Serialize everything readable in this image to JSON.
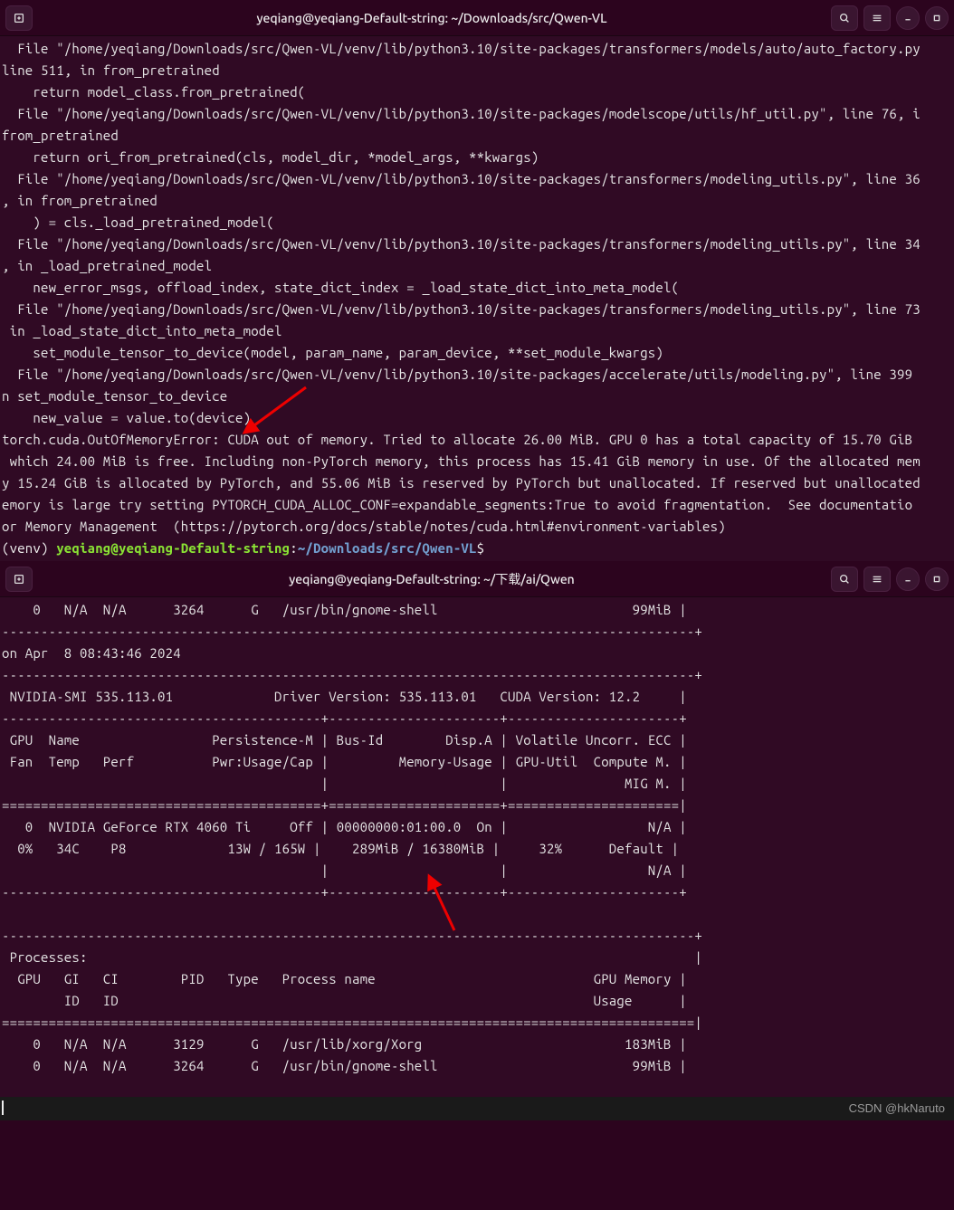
{
  "window1": {
    "title": "yeqiang@yeqiang-Default-string: ~/Downloads/src/Qwen-VL",
    "lines": [
      "  File \"/home/yeqiang/Downloads/src/Qwen-VL/venv/lib/python3.10/site-packages/transformers/models/auto/auto_factory.py",
      "line 511, in from_pretrained",
      "    return model_class.from_pretrained(",
      "  File \"/home/yeqiang/Downloads/src/Qwen-VL/venv/lib/python3.10/site-packages/modelscope/utils/hf_util.py\", line 76, i",
      "from_pretrained",
      "    return ori_from_pretrained(cls, model_dir, *model_args, **kwargs)",
      "  File \"/home/yeqiang/Downloads/src/Qwen-VL/venv/lib/python3.10/site-packages/transformers/modeling_utils.py\", line 36",
      ", in from_pretrained",
      "    ) = cls._load_pretrained_model(",
      "  File \"/home/yeqiang/Downloads/src/Qwen-VL/venv/lib/python3.10/site-packages/transformers/modeling_utils.py\", line 34",
      ", in _load_pretrained_model",
      "    new_error_msgs, offload_index, state_dict_index = _load_state_dict_into_meta_model(",
      "  File \"/home/yeqiang/Downloads/src/Qwen-VL/venv/lib/python3.10/site-packages/transformers/modeling_utils.py\", line 73",
      " in _load_state_dict_into_meta_model",
      "    set_module_tensor_to_device(model, param_name, param_device, **set_module_kwargs)",
      "  File \"/home/yeqiang/Downloads/src/Qwen-VL/venv/lib/python3.10/site-packages/accelerate/utils/modeling.py\", line 399",
      "n set_module_tensor_to_device",
      "    new_value = value.to(device)",
      "torch.cuda.OutOfMemoryError: CUDA out of memory. Tried to allocate 26.00 MiB. GPU 0 has a total capacity of 15.70 GiB",
      " which 24.00 MiB is free. Including non-PyTorch memory, this process has 15.41 GiB memory in use. Of the allocated mem",
      "y 15.24 GiB is allocated by PyTorch, and 55.06 MiB is reserved by PyTorch but unallocated. If reserved but unallocated",
      "emory is large try setting PYTORCH_CUDA_ALLOC_CONF=expandable_segments:True to avoid fragmentation.  See documentatio",
      "or Memory Management  (https://pytorch.org/docs/stable/notes/cuda.html#environment-variables)"
    ],
    "prompt_venv": "(venv) ",
    "prompt_user": "yeqiang@yeqiang-Default-string",
    "prompt_colon": ":",
    "prompt_path": "~/Downloads/src/Qwen-VL",
    "prompt_dollar": "$"
  },
  "window2": {
    "title": "yeqiang@yeqiang-Default-string: ~/下载/ai/Qwen",
    "lines": [
      "    0   N/A  N/A      3264      G   /usr/bin/gnome-shell                         99MiB |",
      "-----------------------------------------------------------------------------------------+",
      "on Apr  8 08:43:46 2024",
      "-----------------------------------------------------------------------------------------+",
      " NVIDIA-SMI 535.113.01             Driver Version: 535.113.01   CUDA Version: 12.2     |",
      "-----------------------------------------+----------------------+----------------------+",
      " GPU  Name                 Persistence-M | Bus-Id        Disp.A | Volatile Uncorr. ECC |",
      " Fan  Temp   Perf          Pwr:Usage/Cap |         Memory-Usage | GPU-Util  Compute M. |",
      "                                         |                      |               MIG M. |",
      "=========================================+======================+======================|",
      "   0  NVIDIA GeForce RTX 4060 Ti     Off | 00000000:01:00.0  On |                  N/A |",
      "  0%   34C    P8             13W / 165W |    289MiB / 16380MiB |     32%      Default |",
      "                                         |                      |                  N/A |",
      "-----------------------------------------+----------------------+----------------------+",
      "                                                                                         ",
      "-----------------------------------------------------------------------------------------+",
      " Processes:                                                                              |",
      "  GPU   GI   CI        PID   Type   Process name                            GPU Memory |",
      "        ID   ID                                                             Usage      |",
      "=========================================================================================|",
      "    0   N/A  N/A      3129      G   /usr/lib/xorg/Xorg                          183MiB |",
      "    0   N/A  N/A      3264      G   /usr/bin/gnome-shell                         99MiB |"
    ]
  },
  "watermark": "CSDN @hkNaruto"
}
